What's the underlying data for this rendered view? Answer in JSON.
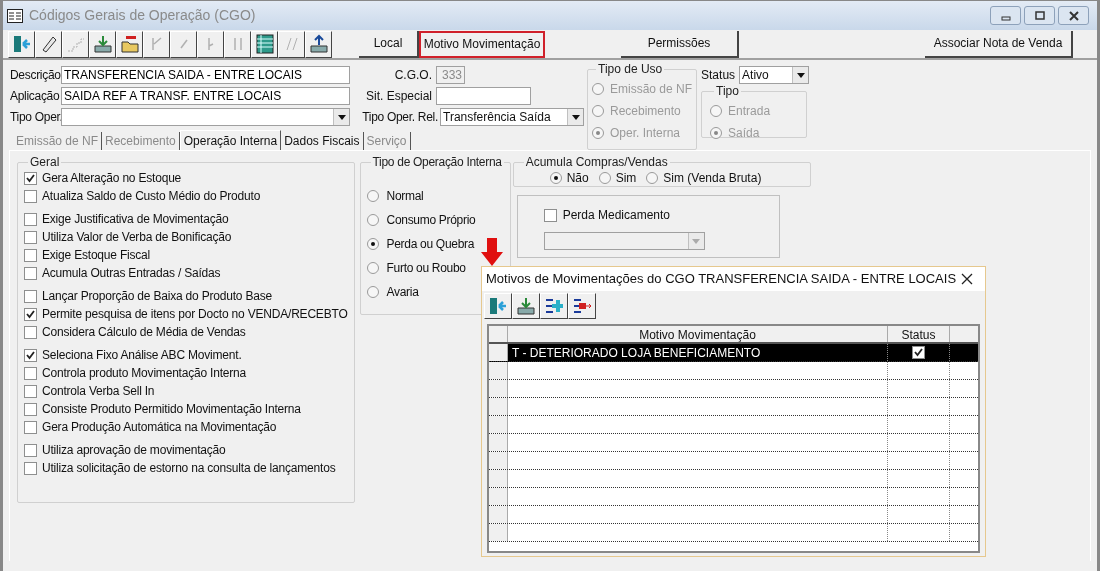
{
  "window": {
    "title": "Códigos Gerais de Operação (CGO)"
  },
  "toolbar": [
    {
      "kind": "exit",
      "disabled": false
    },
    {
      "kind": "edit",
      "disabled": false
    },
    {
      "kind": "copy",
      "disabled": true
    },
    {
      "kind": "save",
      "disabled": false
    },
    {
      "kind": "delete",
      "disabled": false
    },
    {
      "kind": "first",
      "disabled": true
    },
    {
      "kind": "prev",
      "disabled": true
    },
    {
      "kind": "next",
      "disabled": true
    },
    {
      "kind": "last",
      "disabled": true
    },
    {
      "kind": "grid",
      "disabled": false
    },
    {
      "kind": "undo",
      "disabled": true
    },
    {
      "kind": "export",
      "disabled": false
    }
  ],
  "buttons": [
    {
      "label": "Local",
      "highlighted": false
    },
    {
      "label": "Motivo Movimentação",
      "highlighted": true
    },
    {
      "label": "Permissões",
      "highlighted": false
    },
    {
      "label": "Associar Nota de Venda",
      "highlighted": false
    }
  ],
  "form": {
    "descricao": {
      "label": "Descrição",
      "value": "TRANSFERENCIA SAIDA - ENTRE LOCAIS"
    },
    "aplicacao": {
      "label": "Aplicação",
      "value": "SAIDA REF A TRANSF. ENTRE LOCAIS"
    },
    "tipo_oper": {
      "label": "Tipo Oper."
    },
    "cgo": {
      "label": "C.G.O.",
      "value": "333",
      "disabled": true
    },
    "sit_especial": {
      "label": "Sit. Especial"
    },
    "tipo_oper_rel": {
      "label": "Tipo Oper. Rel.",
      "value": "Transferência Saída"
    },
    "tipo_de_uso": {
      "title": "Tipo de Uso",
      "disabled": true,
      "options": [
        {
          "label": "Emissão de NF",
          "selected": false
        },
        {
          "label": "Recebimento",
          "selected": false
        },
        {
          "label": "Oper. Interna",
          "selected": true
        }
      ]
    },
    "status": {
      "label": "Status",
      "value": "Ativo"
    },
    "tipo": {
      "title": "Tipo",
      "disabled": true,
      "options": [
        {
          "label": "Entrada",
          "selected": false
        },
        {
          "label": "Saída",
          "selected": true
        }
      ]
    }
  },
  "tabs": [
    {
      "label": "Emissão de NF",
      "selected": false,
      "disabled": true
    },
    {
      "label": "Recebimento",
      "selected": false,
      "disabled": true
    },
    {
      "label": "Operação Interna",
      "selected": true,
      "disabled": false
    },
    {
      "label": "Dados Fiscais",
      "selected": false,
      "disabled": false
    },
    {
      "label": "Serviço",
      "selected": false,
      "disabled": true
    }
  ],
  "geral": {
    "title": "Geral",
    "sections": [
      [
        {
          "label": "Gera Alteração no Estoque",
          "checked": true
        },
        {
          "label": "Atualiza Saldo de Custo Médio do Produto",
          "checked": false
        }
      ],
      [
        {
          "label": "Exige Justificativa de Movimentação",
          "checked": false
        },
        {
          "label": "Utiliza Valor de Verba de Bonificação",
          "checked": false
        },
        {
          "label": "Exige Estoque Fiscal",
          "checked": false
        },
        {
          "label": "Acumula Outras Entradas / Saídas",
          "checked": false
        }
      ],
      [
        {
          "label": "Lançar Proporção de Baixa do Produto Base",
          "checked": false
        },
        {
          "label": "Permite pesquisa de itens por Docto no VENDA/RECEBTO",
          "checked": true
        },
        {
          "label": "Considera Cálculo de Média de Vendas",
          "checked": false
        }
      ],
      [
        {
          "label": "Seleciona Fixo Análise ABC Moviment.",
          "checked": true
        },
        {
          "label": "Controla produto Movimentação Interna",
          "checked": false
        },
        {
          "label": "Controla Verba Sell In",
          "checked": false
        },
        {
          "label": "Consiste Produto Permitido Movimentação Interna",
          "checked": false
        },
        {
          "label": "Gera Produção Automática na Movimentação",
          "checked": false
        }
      ],
      [
        {
          "label": "Utiliza aprovação de movimentação",
          "checked": false
        },
        {
          "label": "Utiliza solicitação de estorno na consulta de lançamentos",
          "checked": false
        }
      ]
    ]
  },
  "tipo_operacao_interna": {
    "title": "Tipo de Operação Interna",
    "options": [
      {
        "label": "Normal",
        "selected": false
      },
      {
        "label": "Consumo Próprio",
        "selected": false
      },
      {
        "label": "Perda ou Quebra",
        "selected": true
      },
      {
        "label": "Furto ou Roubo",
        "selected": false
      },
      {
        "label": "Avaria",
        "selected": false
      }
    ]
  },
  "acumula": {
    "title": "Acumula Compras/Vendas",
    "options": [
      {
        "label": "Não",
        "selected": true
      },
      {
        "label": "Sim",
        "selected": false
      },
      {
        "label": "Sim (Venda Bruta)",
        "selected": false
      }
    ]
  },
  "perda_medicamento": {
    "label": "Perda Medicamento",
    "checked": false
  },
  "dialog": {
    "title": "Motivos de Movimentações do CGO TRANSFERENCIA SAIDA - ENTRE LOCAIS",
    "toolbar": [
      {
        "kind": "exit"
      },
      {
        "kind": "save"
      },
      {
        "kind": "add"
      },
      {
        "kind": "remove"
      }
    ],
    "columns": [
      "Motivo Movimentação",
      "Status"
    ],
    "rows": [
      {
        "motivo": "T - DETERIORADO LOJA BENEFICIAMENTO",
        "status": true,
        "selected": true
      }
    ]
  }
}
